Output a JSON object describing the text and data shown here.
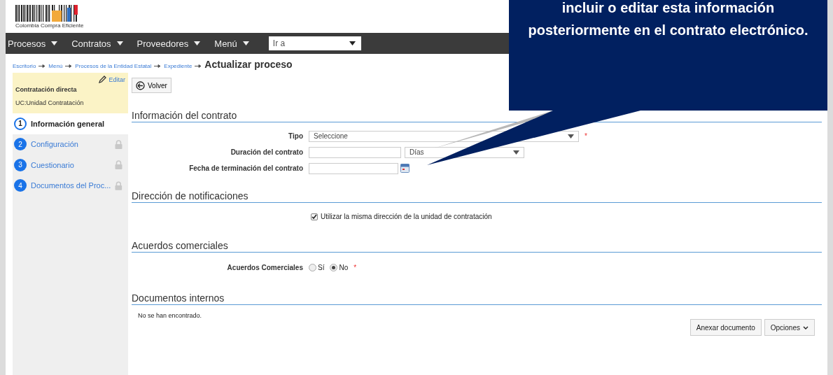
{
  "header": {
    "logo_text": "Colombia Compra Eficiente"
  },
  "nav": {
    "menus": [
      "Procesos",
      "Contratos",
      "Proveedores",
      "Menú"
    ],
    "goto": {
      "value": "Ir a"
    }
  },
  "breadcrumb": {
    "links": [
      "Escritorio",
      "Menú",
      "Procesos de la Entidad Estatal",
      "Expediente"
    ],
    "current": "Actualizar proceso"
  },
  "sidebar": {
    "edit_link": "Editar",
    "process_type": "Contratación directa",
    "unit": "UC:Unidad Contratación",
    "steps": [
      {
        "number": "1",
        "label": "Información general",
        "selected": true,
        "locked": false
      },
      {
        "number": "2",
        "label": "Configuración",
        "selected": false,
        "locked": true
      },
      {
        "number": "3",
        "label": "Cuestionario",
        "selected": false,
        "locked": true
      },
      {
        "number": "4",
        "label": "Documentos del Proc...",
        "selected": false,
        "locked": true
      }
    ]
  },
  "back_button": "Volver",
  "contract_info": {
    "title": "Información del contrato",
    "fields": [
      {
        "kind": "select",
        "label": "Tipo",
        "value": "Seleccione",
        "required_mark": "*"
      },
      {
        "kind": "duration",
        "label": "Duración del contrato",
        "unit": "Días"
      },
      {
        "kind": "date",
        "label": "Fecha de terminación del contrato"
      }
    ]
  },
  "notifications": {
    "title": "Dirección de notificaciones",
    "same_address": {
      "label": "Utilizar la misma dirección de la unidad de contratación",
      "checked": true
    }
  },
  "trade_agreements": {
    "title": "Acuerdos comerciales",
    "label": "Acuerdos Comerciales",
    "options": [
      {
        "label": "Sí",
        "selected": false
      },
      {
        "label": "No",
        "selected": true
      }
    ],
    "required_mark": "*"
  },
  "internal_documents": {
    "title": "Documentos internos",
    "empty_message": "No se han encontrado.",
    "buttons": [
      {
        "kind": "plain",
        "label": "Anexar documento"
      },
      {
        "kind": "menu",
        "label": "Opciones"
      }
    ]
  },
  "callout": {
    "text": "incluir o editar esta información posteriormente en el contrato electrónico."
  }
}
